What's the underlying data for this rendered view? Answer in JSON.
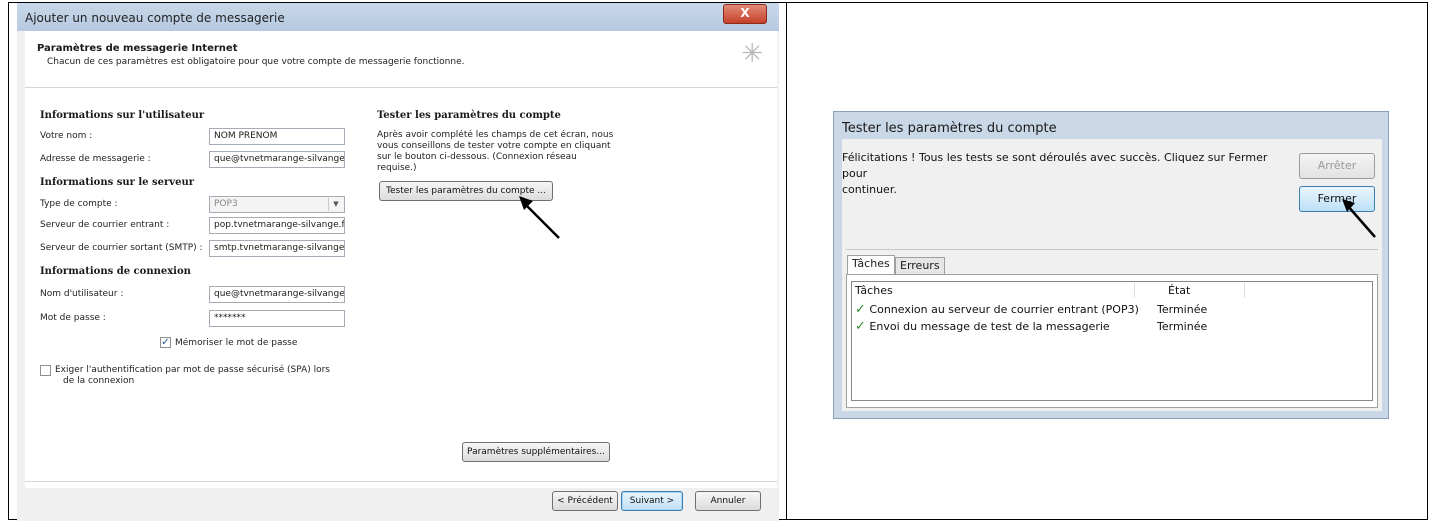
{
  "left_dialog": {
    "title": "Ajouter un nouveau compte de messagerie",
    "close_label": "X",
    "header": {
      "title": "Paramètres de messagerie Internet",
      "subtitle": "Chacun de ces paramètres est obligatoire pour que votre compte de messagerie fonctionne."
    },
    "user_info": {
      "section": "Informations sur l'utilisateur",
      "name_label": "Votre nom :",
      "name_value": "NOM PRENOM",
      "email_label": "Adresse de messagerie :",
      "email_value": "que@tvnetmarange-silvange.fr"
    },
    "server_info": {
      "section": "Informations sur le serveur",
      "account_type_label": "Type de compte :",
      "account_type_value": "POP3",
      "incoming_label": "Serveur de courrier entrant :",
      "incoming_value": "pop.tvnetmarange-silvange.fr",
      "outgoing_label": "Serveur de courrier sortant (SMTP) :",
      "outgoing_value": "smtp.tvnetmarange-silvange.fr"
    },
    "login_info": {
      "section": "Informations de connexion",
      "username_label": "Nom d'utilisateur :",
      "username_value": "que@tvnetmarange-silvange.fr",
      "password_label": "Mot de passe :",
      "password_value": "*******",
      "remember_label": "Mémoriser le mot de passe",
      "spa_label_line1": "Exiger l'authentification par mot de passe sécurisé (SPA) lors",
      "spa_label_line2": "de la connexion"
    },
    "test_section": {
      "title": "Tester les paramètres du compte",
      "line1": "Après avoir complété les champs de cet écran, nous",
      "line2": "vous conseillons de tester votre compte en cliquant",
      "line3": "sur le bouton ci-dessous. (Connexion réseau",
      "line4": "requise.)",
      "button": "Tester les paramètres du compte ..."
    },
    "more_settings_button": "Paramètres supplémentaires...",
    "footer": {
      "back": "< Précédent",
      "next": "Suivant >",
      "cancel": "Annuler"
    }
  },
  "right_dialog": {
    "title": "Tester les paramètres du compte",
    "message_line1": "Félicitations ! Tous les tests se sont déroulés avec succès. Cliquez sur Fermer pour",
    "message_line2": "continuer.",
    "stop_button": "Arrêter",
    "close_button": "Fermer",
    "tabs": [
      "Tâches",
      "Erreurs"
    ],
    "columns": [
      "Tâches",
      "État"
    ],
    "rows": [
      {
        "task": "Connexion au serveur de courrier entrant (POP3)",
        "status": "Terminée"
      },
      {
        "task": "Envoi du message de test de la messagerie",
        "status": "Terminée"
      }
    ]
  }
}
